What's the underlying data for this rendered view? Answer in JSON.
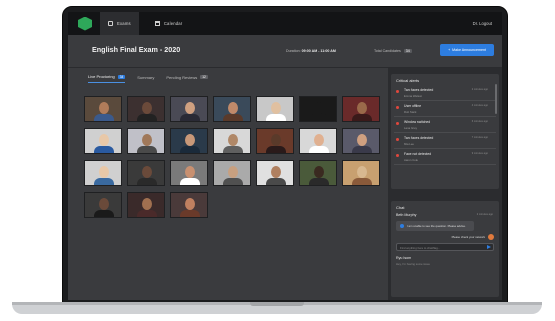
{
  "nav": {
    "tabs": [
      {
        "label": "Exams",
        "icon": "grid-icon"
      },
      {
        "label": "Calendar",
        "icon": "calendar-icon"
      }
    ],
    "logout": "Dr. Logout"
  },
  "header": {
    "title": "English Final Exam - 2020",
    "duration_label": "Duration:",
    "duration_value": "09:00 AM - 11:00 AM",
    "total_label": "Total Candidates",
    "total_value": "34",
    "announce_button": "Make Announcement"
  },
  "tabs": [
    {
      "label": "Live Proctoring",
      "badge": "34"
    },
    {
      "label": "Summary",
      "badge": ""
    },
    {
      "label": "Pending Reviews",
      "badge": "12"
    }
  ],
  "colors": {
    "accent": "#2d7de0",
    "alert": "#e0473d",
    "brand": "#2ea85a"
  },
  "critical": {
    "title": "Critical alerts",
    "alerts": [
      {
        "title": "Two faces detected",
        "sub": "Emma Watson",
        "time": "2 minutes ago"
      },
      {
        "title": "User offline",
        "sub": "Rob Stark",
        "time": "4 minutes ago"
      },
      {
        "title": "Window switched",
        "sub": "Lana Grey",
        "time": "6 minutes ago"
      },
      {
        "title": "Two faces detected",
        "sub": "Mia Lee",
        "time": "7 minutes ago"
      },
      {
        "title": "Face not detected",
        "sub": "Aaron Cole",
        "time": "9 minutes ago"
      }
    ]
  },
  "chat": {
    "title": "Chat",
    "sender": "Beth Murphy",
    "time": "2 minutes ago",
    "message": "I am unable to see the question. Please advise.",
    "reply": "Please check your network",
    "input_placeholder": "Find anything here to chat/flag...",
    "next_sender": "Ryu Isom",
    "next_sub": "Hey, I'm having some issue"
  }
}
